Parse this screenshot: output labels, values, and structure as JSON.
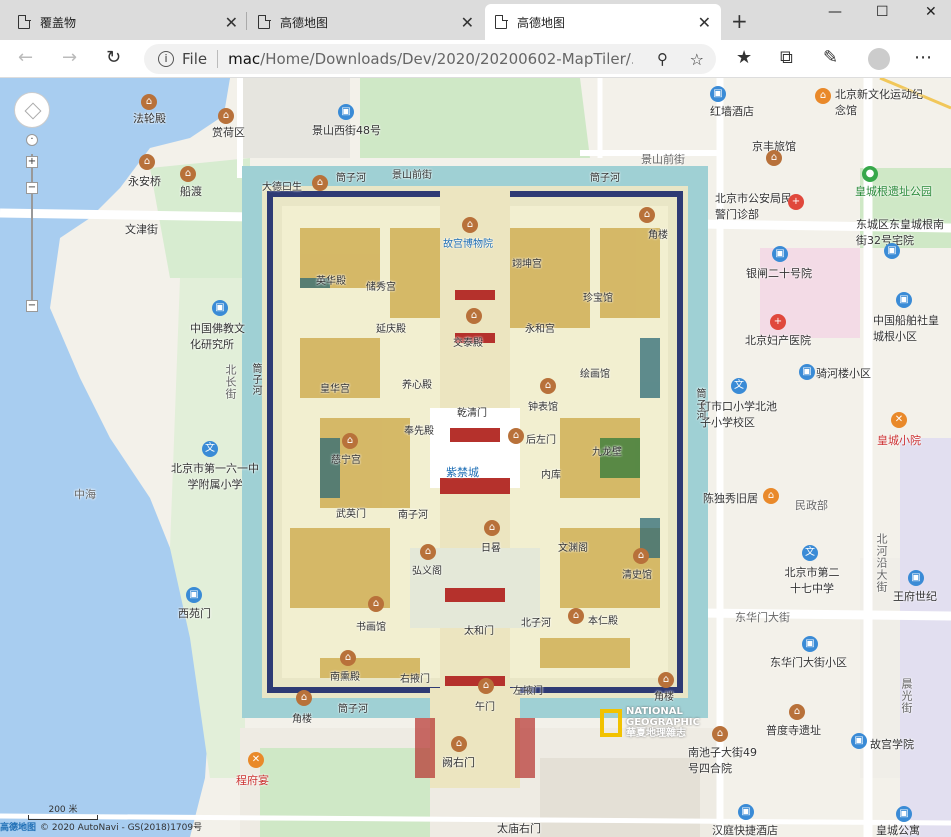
{
  "tabs": [
    {
      "label": "覆盖物",
      "active": false
    },
    {
      "label": "高德地图",
      "active": false
    },
    {
      "label": "高德地图",
      "active": true
    }
  ],
  "toolbar": {
    "scheme": "File",
    "url_strong": "mac",
    "url_rest": "/Home/Downloads/Dev/2020/20200602-MapTiler/..."
  },
  "map": {
    "labels": {
      "falun": "法轮殿",
      "shangshe": "赏荷区",
      "yongan": "永安桥",
      "chuandu": "船渡",
      "wenjin": "文津街",
      "jingshan48": "景山西街48号",
      "jingshanqian": "景山前街",
      "hongqiang": "红墙酒店",
      "xinwenhua": "北京新文化运动纪念馆",
      "jingfeng": "京丰旅馆",
      "gongan": "北京市公安局民警门诊部",
      "huangcheng": "皇城根遗址公园",
      "dongcheng32": "东城区东皇城根南街32号宅院",
      "yinzha": "银闸二十号院",
      "foxiao": "中国佛教文化研究所",
      "beijiefukang": "北京妇产医院",
      "chuanban": "中国船舶社皇城根小区",
      "qihe": "骑河楼小区",
      "dengshi": "灯市口小学北池子小学校区",
      "huangchengxiao": "皇城小院",
      "beilong": "北长街",
      "liuyi": "北京市第一六一中学附属小学",
      "zhonghai": "中海",
      "chendu": "陈独秀旧居",
      "minzhengbu": "民政部",
      "xiyuanmen": "西苑门",
      "beiheyan": "北河沿大街",
      "erqi": "北京市第二十七中学",
      "wangfu": "王府世纪",
      "donghuamen": "东华门大街",
      "donghuaxiao": "东华门大街小区",
      "puduo": "普度寺遗址",
      "chenguang": "晨光街",
      "gugongxue": "故宫学院",
      "chengfu": "程府宴",
      "nanchizi": "南池子大街49号四合院",
      "queyou": "阙右门",
      "taimiao": "太庙右门",
      "hanting": "汉庭快捷酒店",
      "huanghun": "皇城公寓",
      "dade": "大德曰生",
      "jingshanjie": "景山前街",
      "yinghuadian": "英华殿",
      "gugongbowu": "故宫博物院",
      "jiaolou_ne": "角楼",
      "jiaolou_nw": "角楼",
      "jiaolou_se": "角楼",
      "jiaolou_sw": "角楼",
      "chuxiu": "储秀宫",
      "yikun": "翊坤宫",
      "yanqing": "延庆殿",
      "jiaotai": "交泰殿",
      "yonghe": "永和宫",
      "zhongcui": "钟粹宫",
      "qianqing": "乾清门",
      "yangxin": "养心殿",
      "houzuo": "后左门",
      "jiulong": "九龙壁",
      "cining": "慈宁宫",
      "neiku": "内库",
      "wuying": "武英门",
      "riyi": "日晷",
      "wenyuan": "文渊阁",
      "hongyi": "弘义阁",
      "qingshi": "清史馆",
      "taihe": "太和门",
      "shugu": "书画馆",
      "benren": "本仁殿",
      "nanxun": "南熏殿",
      "youyi": "右掖门",
      "wumen": "午门",
      "zuoye": "左掖门",
      "jiaolou2": "角楼",
      "zizhong": "紫禁城",
      "nanzi": "南子河",
      "beizi": "北子河",
      "huiwei": "绘画馆",
      "zhongbiao": "钟表馆",
      "zhenbao": "珍宝馆",
      "huanghua": "皇华宫",
      "fengxian": "奉先殿"
    },
    "moat_labels": {
      "north": "筒子河",
      "south": "筒子河",
      "west": "筒子河",
      "east": "筒子河"
    },
    "scale": "200 米",
    "copyright_logo": "高德地图",
    "copyright_text": "© 2020 AutoNavi - GS(2018)1709号",
    "ng_line1": "NATIONAL",
    "ng_line2": "GEOGRAPHIC",
    "ng_line3": "華夏地理雜志"
  }
}
